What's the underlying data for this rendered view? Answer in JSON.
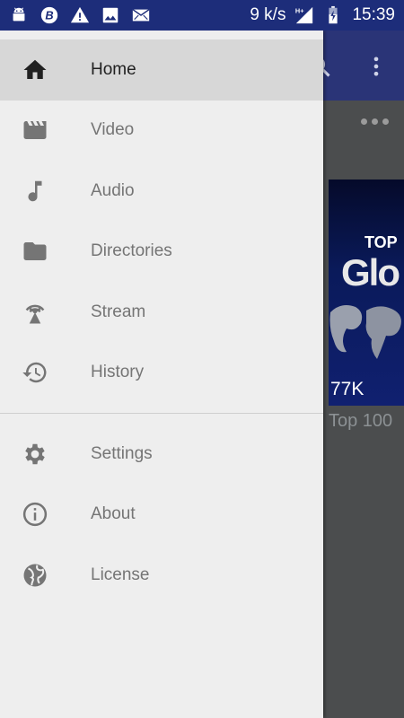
{
  "status_bar": {
    "net_speed": "9 k/s",
    "time": "15:39",
    "network_type": "H+",
    "icons": [
      "android-icon",
      "b-app-icon",
      "warning-icon",
      "image-icon",
      "mail-icon",
      "signal-icon",
      "battery-charging-icon"
    ]
  },
  "background": {
    "thumbnail_line1": "TOP",
    "thumbnail_line2": "Glo",
    "views": "77K",
    "title": "Top 100"
  },
  "drawer": {
    "items": [
      {
        "label": "Home",
        "icon": "home-icon",
        "selected": true
      },
      {
        "label": "Video",
        "icon": "video-icon",
        "selected": false
      },
      {
        "label": "Audio",
        "icon": "music-note-icon",
        "selected": false
      },
      {
        "label": "Directories",
        "icon": "folder-icon",
        "selected": false
      },
      {
        "label": "Stream",
        "icon": "stream-antenna-icon",
        "selected": false
      },
      {
        "label": "History",
        "icon": "history-icon",
        "selected": false
      }
    ],
    "secondary_items": [
      {
        "label": "Settings",
        "icon": "gear-icon"
      },
      {
        "label": "About",
        "icon": "info-icon"
      },
      {
        "label": "License",
        "icon": "globe-icon"
      }
    ]
  },
  "colors": {
    "status_bar": "#1d2d7a",
    "toolbar": "#2a3477",
    "drawer_bg": "#eeeeee",
    "selected_bg": "#d7d7d7",
    "icon": "#757575",
    "selected_icon": "#212121"
  }
}
